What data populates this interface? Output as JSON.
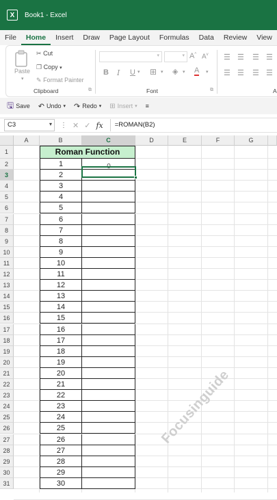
{
  "window": {
    "title": "Book1  -  Excel",
    "app_icon": "excel-icon"
  },
  "tabs": [
    "File",
    "Home",
    "Insert",
    "Draw",
    "Page Layout",
    "Formulas",
    "Data",
    "Review",
    "View"
  ],
  "active_tab": "Home",
  "ribbon": {
    "paste_label": "Paste",
    "cut_label": "Cut",
    "copy_label": "Copy",
    "format_painter_label": "Format Painter",
    "clipboard_group": "Clipboard",
    "font_group": "Font",
    "bold": "B",
    "italic": "I",
    "underline": "U",
    "grow_font": "A",
    "shrink_font": "A",
    "font_color": "A",
    "partial_group_letter": "A"
  },
  "qat": {
    "save_label": "Save",
    "undo_label": "Undo",
    "redo_label": "Redo",
    "insert_label": "Insert"
  },
  "formula_bar": {
    "name_box": "C3",
    "fx": "fx",
    "formula": "=ROMAN(B2)"
  },
  "columns": [
    "A",
    "B",
    "C",
    "D",
    "E",
    "F",
    "G"
  ],
  "selected_column": "C",
  "selected_row": 3,
  "rows": [
    1,
    2,
    3,
    4,
    5,
    6,
    7,
    8,
    9,
    10,
    11,
    12,
    13,
    14,
    15,
    16,
    17,
    18,
    19,
    20,
    21,
    22,
    23,
    24,
    25,
    26,
    27,
    28,
    29,
    30,
    31
  ],
  "table": {
    "header": "Roman Function",
    "values": [
      1,
      2,
      3,
      4,
      5,
      6,
      7,
      8,
      9,
      10,
      11,
      12,
      13,
      14,
      15,
      16,
      17,
      18,
      19,
      20,
      21,
      22,
      23,
      24,
      25,
      26,
      27,
      28,
      29,
      30
    ],
    "editing_value": "0"
  },
  "watermark": "Focusinguide",
  "colors": {
    "excel_green": "#1a7343",
    "header_fill": "#c6efce"
  }
}
